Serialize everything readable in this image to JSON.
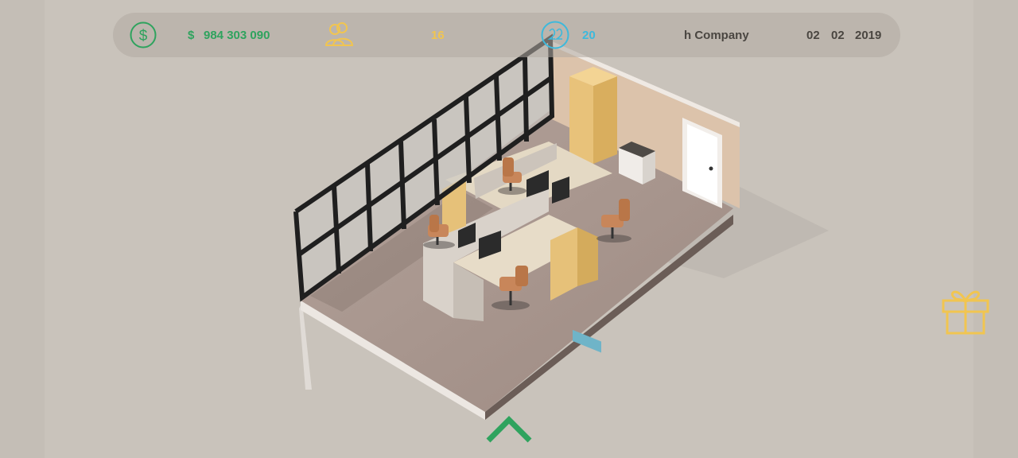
{
  "hud": {
    "money_icon": "dollar-circle-icon",
    "money_symbol": "$",
    "money_amount": "984 303 090",
    "staff_icon": "people-icon",
    "staff_count": "16",
    "timer_icon": "timer-icon",
    "timer_value": "20",
    "company_name": "h Company",
    "date_day": "02",
    "date_month": "02",
    "date_year": "2019"
  },
  "gift_icon": "gift-icon",
  "expand_icon": "chevron-up-icon",
  "colors": {
    "money": "#2fa35e",
    "staff": "#f1c550",
    "timer": "#3db9dc",
    "text_dark": "#4a4641",
    "background": "#c9c3bb"
  }
}
